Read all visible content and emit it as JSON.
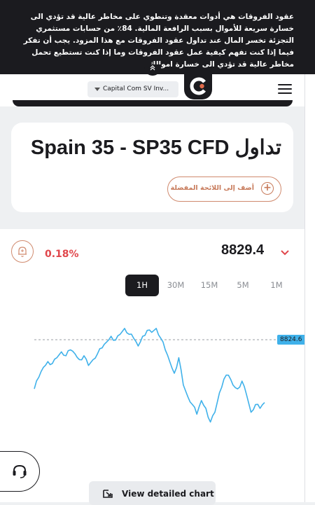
{
  "risk_warning": {
    "text": "عقود الفروقات هي أدوات معقدة وتنطوي على مخاطر عالية قد تؤدي الى خسارة سريعة للأموال بسبب الرافعة المالية. 84٪ من حسابات مستثمري التجزئة تخسر المال عند تداول عقود الفروقات مع هذا المزود. يجب أن تفكر فيما إذا كنت تفهم كيفية عمل عقود الفروقات وما إذا كنت تستطيع تحمل مخاطر عالية قد تؤدي الى خسارة اموالك.",
    "collapse_icon": "double-chevron-up-icon"
  },
  "header": {
    "entity_selector": "Capital Com SV Inv...",
    "logo_icon": "capital-com-logo",
    "menu_icon": "hamburger-menu-icon"
  },
  "instrument": {
    "title": "تداول Spain 35 - SP35 CFD",
    "add_to_favorites": "أضف إلى اللائحة المفضلة",
    "add_icon": "plus-circle-icon"
  },
  "quote": {
    "price": "8829.4",
    "change": "0.18%",
    "alert_icon": "bell-icon",
    "expand_icon": "chevron-down-icon"
  },
  "timeframes": {
    "items": [
      "1H",
      "30M",
      "15M",
      "5M",
      "1M"
    ],
    "active": "1H"
  },
  "chart_data": {
    "type": "line",
    "series": [
      {
        "values": [
          8812.0,
          8815.0,
          8817.5,
          8819.0,
          8818.5,
          8820.0,
          8821.5,
          8820.5,
          8822.0,
          8821.0,
          8819.5,
          8820.5,
          8818.0,
          8819.5,
          8821.0,
          8822.5,
          8824.0,
          8825.5,
          8824.5,
          8826.0,
          8827.5,
          8826.0,
          8825.0,
          8823.0,
          8825.5,
          8827.0,
          8826.5,
          8827.5,
          8825.0,
          8822.0,
          8819.0,
          8816.0,
          8820.0,
          8813.0,
          8810.0,
          8808.0,
          8805.5,
          8809.0,
          8807.0,
          8803.5,
          8806.0,
          8811.0,
          8814.5,
          8815.5,
          8813.0,
          8812.0,
          8814.0,
          8810.5,
          8806.0,
          8808.0,
          8807.0,
          8808.5
        ]
      }
    ],
    "last_value": "8824.6",
    "color": "#3fb1ea",
    "reference_line": "dashed-gray"
  },
  "support_icon": "headset-icon",
  "view_detailed_chart": {
    "label": "View detailed chart",
    "icon": "expand-arrow-icon"
  }
}
